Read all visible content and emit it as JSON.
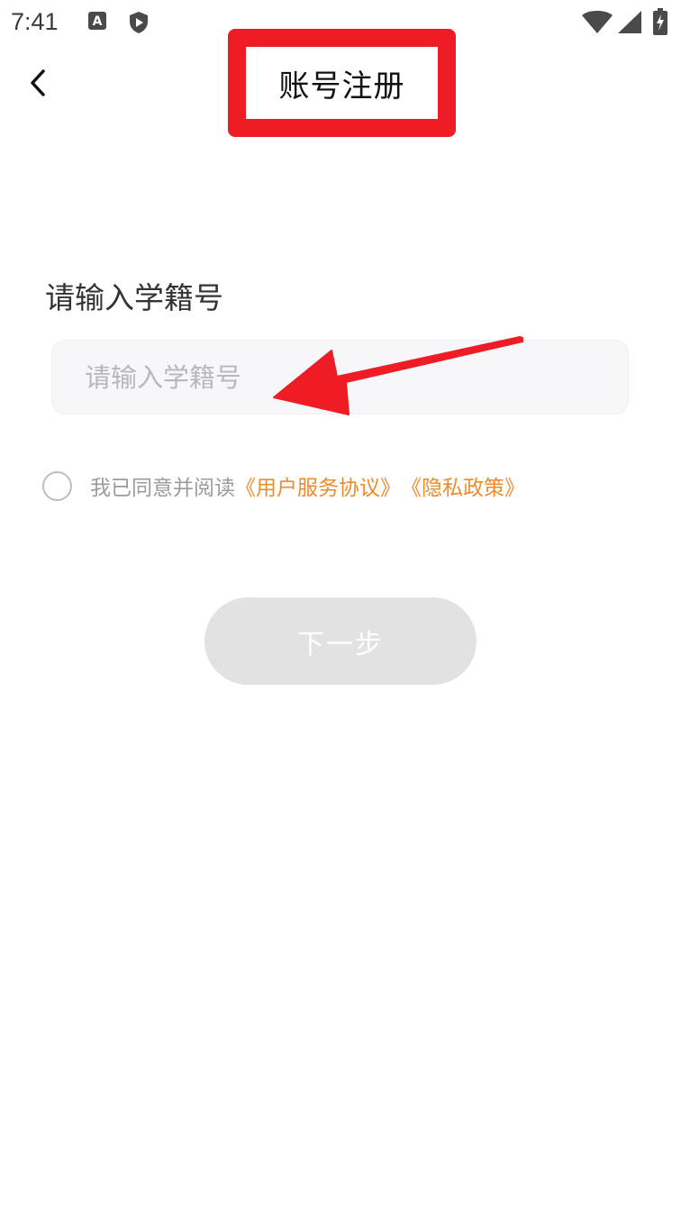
{
  "status_bar": {
    "time": "7:41",
    "icons": [
      "a-notification-icon",
      "shield-play-icon",
      "wifi-icon",
      "signal-icon",
      "battery-charging-icon"
    ]
  },
  "nav": {
    "title": "账号注册",
    "back_icon": "chevron-left-icon",
    "highlight_color": "#ee1c25"
  },
  "form": {
    "label": "请输入学籍号",
    "input_placeholder": "请输入学籍号",
    "input_value": ""
  },
  "agreement": {
    "checked": false,
    "text": "我已同意并阅读",
    "links": [
      "《用户服务协议》",
      "《隐私政策》"
    ],
    "link_color": "#ef8a2d"
  },
  "next_button": {
    "label": "下一步",
    "enabled": false
  },
  "annotation": {
    "arrow_color": "#ee1c25"
  }
}
